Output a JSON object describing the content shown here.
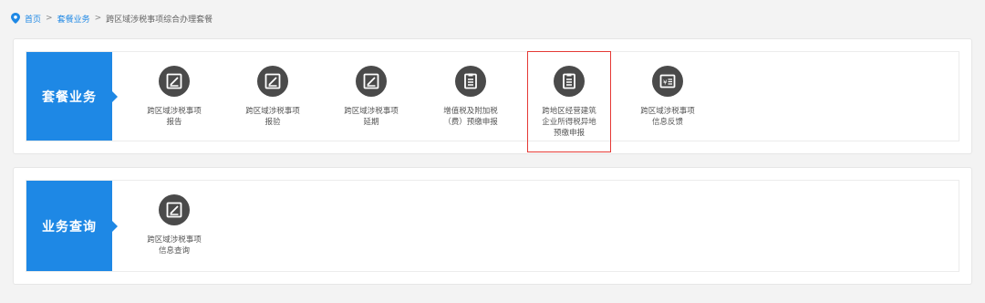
{
  "breadcrumb": {
    "home": "首页",
    "separator": ">",
    "category": "套餐业务",
    "current": "跨区域涉税事项综合办理套餐"
  },
  "sections": [
    {
      "label": "套餐业务",
      "items": [
        {
          "text": "跨区域涉税事项\n报告",
          "icon": "edit-icon"
        },
        {
          "text": "跨区域涉税事项\n报验",
          "icon": "edit-icon"
        },
        {
          "text": "跨区域涉税事项\n延期",
          "icon": "edit-icon"
        },
        {
          "text": "增值税及附加税\n（费）预缴申报",
          "icon": "document-icon"
        },
        {
          "text": "跨地区经营建筑\n企业所得税异地\n预缴申报",
          "icon": "document-icon",
          "highlighted": true
        },
        {
          "text": "跨区域涉税事项\n信息反馈",
          "icon": "yuan-list-icon"
        }
      ]
    },
    {
      "label": "业务查询",
      "items": [
        {
          "text": "跨区域涉税事项\n信息查询",
          "icon": "edit-icon"
        }
      ]
    }
  ],
  "colors": {
    "accent": "#1e88e5",
    "icon_bg": "#4a4a4a",
    "highlight_border": "#e53935"
  }
}
